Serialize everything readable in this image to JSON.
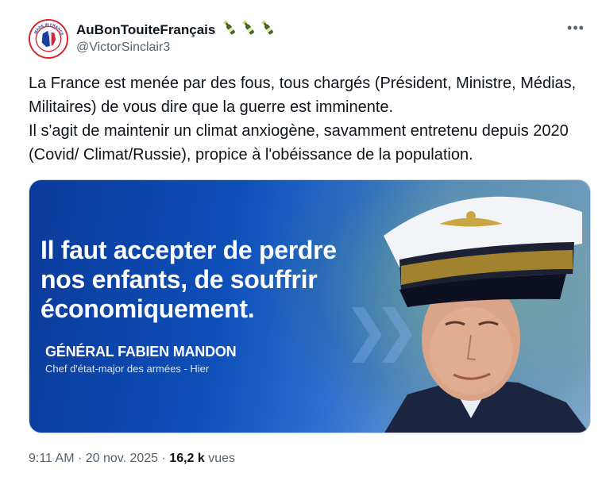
{
  "author": {
    "display_name": "AuBonTouiteFrançais",
    "handle": "@VictorSinclair3",
    "name_emojis": [
      "champagne-icon",
      "champagne-icon",
      "champagne-icon"
    ],
    "avatar_text": "MADE IN FRANCE · FABRICATION FRANÇAISE"
  },
  "more_label": "•••",
  "tweet": {
    "text": "La France est menée par des fous, tous chargés (Président, Ministre, Médias, Militaires) de vous dire que la guerre est imminente.\nIl s'agit de maintenir un climat anxiogène, savamment entretenu depuis 2020 (Covid/ Climat/Russie), propice à l'obéissance de la population."
  },
  "media": {
    "quote": "Il faut accepter de perdre\nnos enfants, de souffrir\néconomiquement.",
    "speaker_name": "GÉNÉRAL FABIEN MANDON",
    "speaker_title": "Chef d'état-major des armées - Hier",
    "chevrons": "❯❯"
  },
  "meta": {
    "time": "9:11 AM",
    "separator": " · ",
    "date": "20 nov. 2025",
    "views_count": "16,2 k",
    "views_label": "vues"
  },
  "colors": {
    "text_primary": "#0f1419",
    "text_secondary": "#536471",
    "media_blue": "#0d4fb8",
    "avatar_red": "#d7262e"
  }
}
